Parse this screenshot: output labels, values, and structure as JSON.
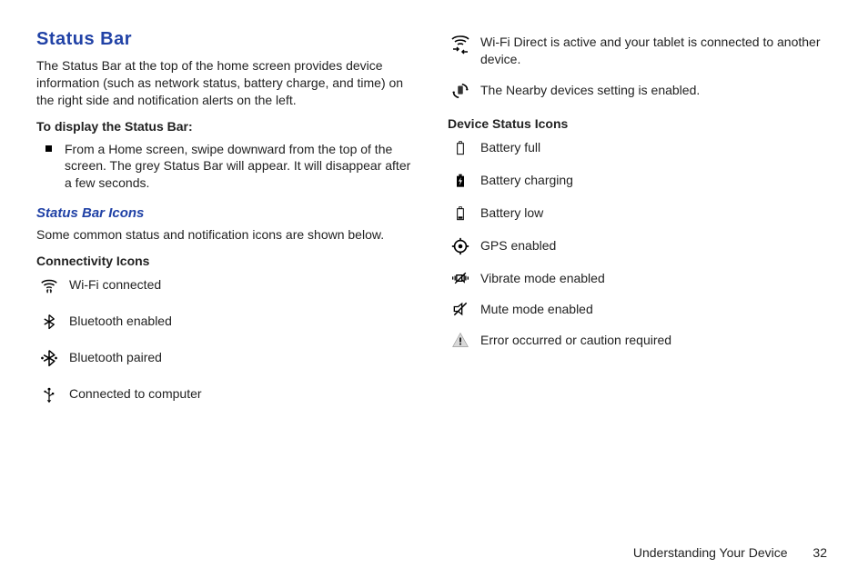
{
  "title": "Status Bar",
  "intro": "The Status Bar at the top of the home screen provides device information (such as network status, battery charge, and time) on the right side and notification alerts on the left.",
  "toDisplayHeading": "To display the Status Bar:",
  "bulletText": "From a Home screen, swipe downward from the top of the screen. The grey Status Bar will appear. It will disappear after a few seconds.",
  "subTitle": "Status Bar Icons",
  "subPara": "Some common status and notification icons are shown below.",
  "connectivityHeading": "Connectivity Icons",
  "connectivity": {
    "wifi": "Wi-Fi connected",
    "btEnabled": "Bluetooth enabled",
    "btPaired": "Bluetooth paired",
    "usb": "Connected to computer",
    "wifiDirect": "Wi-Fi Direct is active and your tablet is connected to another device.",
    "nearby": "The Nearby devices setting is enabled."
  },
  "deviceHeading": "Device Status Icons",
  "device": {
    "batteryFull": "Battery full",
    "batteryCharging": "Battery charging",
    "batteryLow": "Battery low",
    "gps": "GPS enabled",
    "vibrate": "Vibrate mode enabled",
    "mute": "Mute mode enabled",
    "error": "Error occurred or caution required"
  },
  "footer": {
    "section": "Understanding Your Device",
    "page": "32"
  }
}
